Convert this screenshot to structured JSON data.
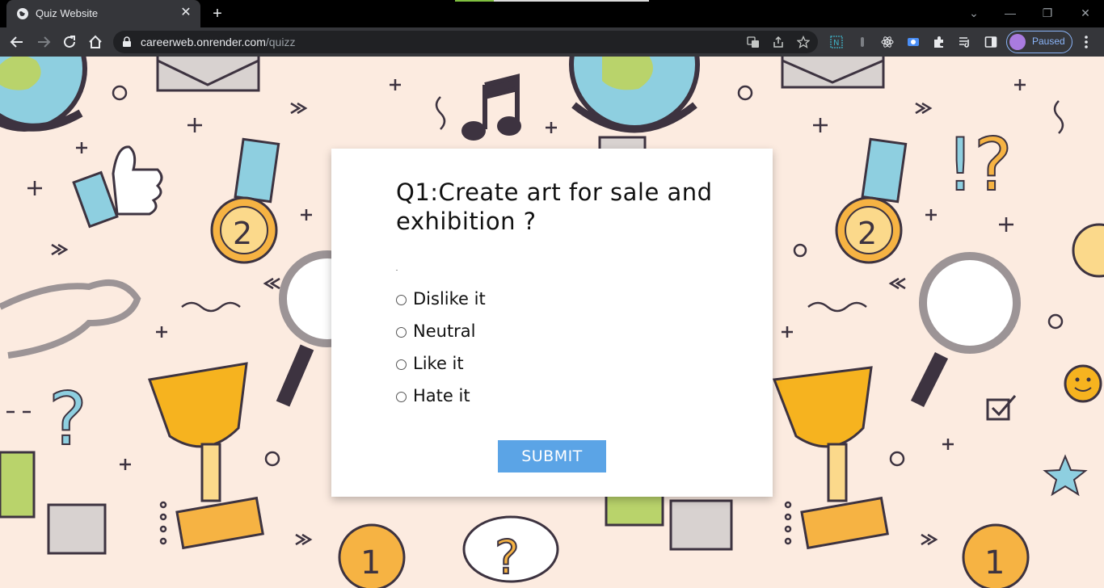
{
  "browser": {
    "tab_title": "Quiz Website",
    "url_host": "careerweb.onrender.com",
    "url_path": "/quizz",
    "profile_status": "Paused",
    "page_load_progress": 0.2
  },
  "quiz": {
    "question": "Q1:Create art for sale and exhibition ?",
    "options": [
      {
        "label": "Dislike it"
      },
      {
        "label": "Neutral"
      },
      {
        "label": "Like it"
      },
      {
        "label": "Hate it"
      }
    ],
    "submit_label": "SUBMIT"
  },
  "colors": {
    "page_background": "#fcebe0",
    "submit_button": "#5ba4e6",
    "chrome_dark": "#35363a",
    "profile_accent": "#8ab4f8"
  }
}
